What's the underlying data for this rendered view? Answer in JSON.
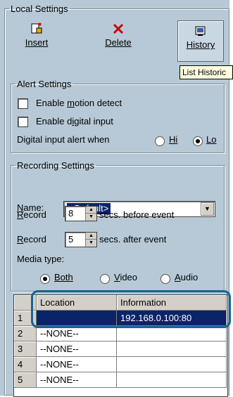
{
  "local_settings": {
    "legend": "Local Settings",
    "toolbar": {
      "insert_label": "Insert",
      "delete_label": "Delete",
      "history_label": "History"
    },
    "tooltip": "List Historic"
  },
  "alert_settings": {
    "legend": "Alert Settings",
    "motion_label": "Enable motion detect",
    "digital_label": "Enable digital input",
    "digital_when_label": "Digital input alert when",
    "hi_label": "Hi",
    "lo_label": "Lo",
    "selected": "Lo"
  },
  "recording_settings": {
    "legend": "Recording Settings",
    "name_label": "Name:",
    "name_value": "<Default>",
    "record_label": "Record",
    "before_value": "8",
    "before_text": "secs. before event",
    "after_value": "5",
    "after_text": "secs. after event",
    "media_type_label": "Media type:",
    "media_options": [
      "Both",
      "Video",
      "Audio"
    ],
    "media_selected": "Both"
  },
  "table": {
    "columns": [
      "Location",
      "Information"
    ],
    "rows": [
      {
        "num": "1",
        "location": "",
        "info": "192.168.0.100:80"
      },
      {
        "num": "2",
        "location": "--NONE--",
        "info": ""
      },
      {
        "num": "3",
        "location": "--NONE--",
        "info": ""
      },
      {
        "num": "4",
        "location": "--NONE--",
        "info": ""
      },
      {
        "num": "5",
        "location": "--NONE--",
        "info": ""
      }
    ]
  },
  "colors": {
    "panel": "#b7c9d6",
    "selection": "#0a246a",
    "highlight": "#17658f"
  }
}
